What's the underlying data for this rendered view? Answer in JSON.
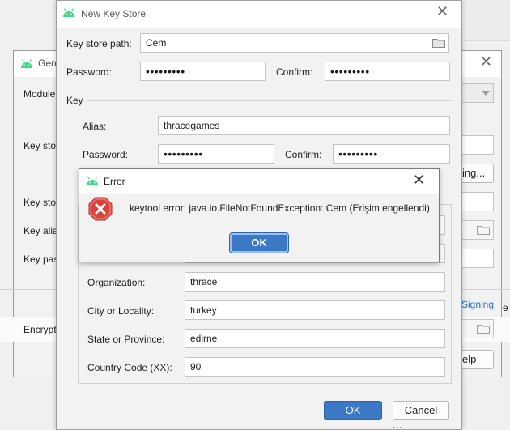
{
  "top_stub_button": {
    "label": ""
  },
  "generate_dialog": {
    "title": "Gen",
    "labels": {
      "module": "Module",
      "key_store": "Key stor",
      "key_store_password": "Key stor",
      "key_alias": "Key alia",
      "key_password": "Key pas",
      "encrypt": "Encrypt"
    },
    "choose_button": "ing...",
    "signing_link": "Signing",
    "help_button": "elp",
    "side_text": "e"
  },
  "new_key_store": {
    "title": "New Key Store",
    "key_store_path_label": "Key store path:",
    "key_store_path_value": "Cem",
    "password_label": "Password:",
    "password_value": "•••••••••",
    "confirm_label": "Confirm:",
    "confirm_value": "•••••••••",
    "key_section": "Key",
    "alias_label": "Alias:",
    "alias_value": "thracegames",
    "key_password_label": "Password:",
    "key_password_value": "•••••••••",
    "key_confirm_label": "Confirm:",
    "key_confirm_value": "•••••••••",
    "organization_label": "Organization:",
    "organization_value": "thrace",
    "city_label": "City or Locality:",
    "city_value": "turkey",
    "state_label": "State or Province:",
    "state_value": "edirne",
    "country_label": "Country Code (XX):",
    "country_value": "90",
    "ok_button": "OK",
    "cancel_button": "Cancel"
  },
  "error_dialog": {
    "title": "Error",
    "message": "keytool error: java.io.FileNotFoundException: Cem (Erişim engellendi)",
    "ok_button": "OK"
  },
  "colors": {
    "primary_button": "#3b79c7",
    "error_icon": "#d8423d",
    "android_green": "#3ddc84",
    "link": "#2f6fbd"
  }
}
